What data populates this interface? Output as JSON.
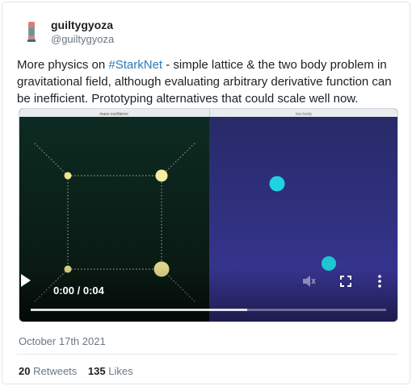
{
  "user": {
    "display_name": "guiltygyoza",
    "handle": "@guiltygyoza"
  },
  "tweet": {
    "text_before": "More physics on ",
    "hashtag": "#StarkNet",
    "text_after": " - simple lattice & the two body problem in gravitational field, although evaluating arbitrary derivative function can be inefficient. Prototyping alternatives that could scale well now."
  },
  "video": {
    "left_panel_title": "mass oscillators",
    "right_panel_title": "two body",
    "time_display": "0:00 / 0:04",
    "progress": 0,
    "buffered": 0.61
  },
  "footer": {
    "date": "October 17th 2021",
    "retweets_count": "20",
    "retweets_label": "Retweets",
    "likes_count": "135",
    "likes_label": "Likes"
  },
  "colors": {
    "link": "#2b7bb9",
    "node": "#f0e38c",
    "body_cyan": "#1fd3e0",
    "left_bg": "#0c2a1f",
    "right_bg_top": "#2a2b6e",
    "right_bg_bottom": "#3d3a9a"
  }
}
